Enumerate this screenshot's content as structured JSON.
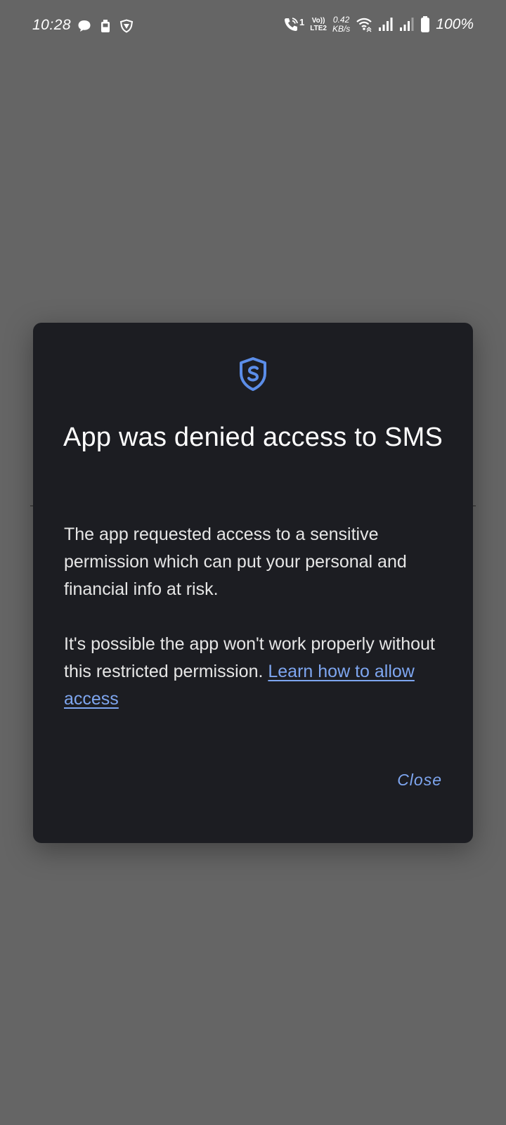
{
  "status_bar": {
    "time": "10:28",
    "volte_top": "Vo))",
    "volte_bottom": "LTE2",
    "call_sim": "1",
    "net_speed_value": "0.42",
    "net_speed_unit": "KB/s",
    "battery": "100%",
    "icons": [
      "chat-bubble-icon",
      "battery-saver-icon",
      "vpn-shield-icon",
      "wifi-calling-icon",
      "wifi-icon",
      "signal-sim1-icon",
      "signal-sim2-icon",
      "battery-icon"
    ]
  },
  "dialog": {
    "icon": "shield-icon",
    "title": "App was denied access to SMS",
    "paragraph1": "The app requested access to a sensitive permission which can put your personal and financial info at risk.",
    "paragraph2": "It's possible the app won't work properly without this restricted permission. ",
    "link_text": "Learn how to allow access",
    "close_label": "Close"
  },
  "colors": {
    "background": "#656565",
    "dialog_bg": "#1c1d22",
    "accent": "#7ea6f0",
    "shield": "#5b8de8"
  }
}
